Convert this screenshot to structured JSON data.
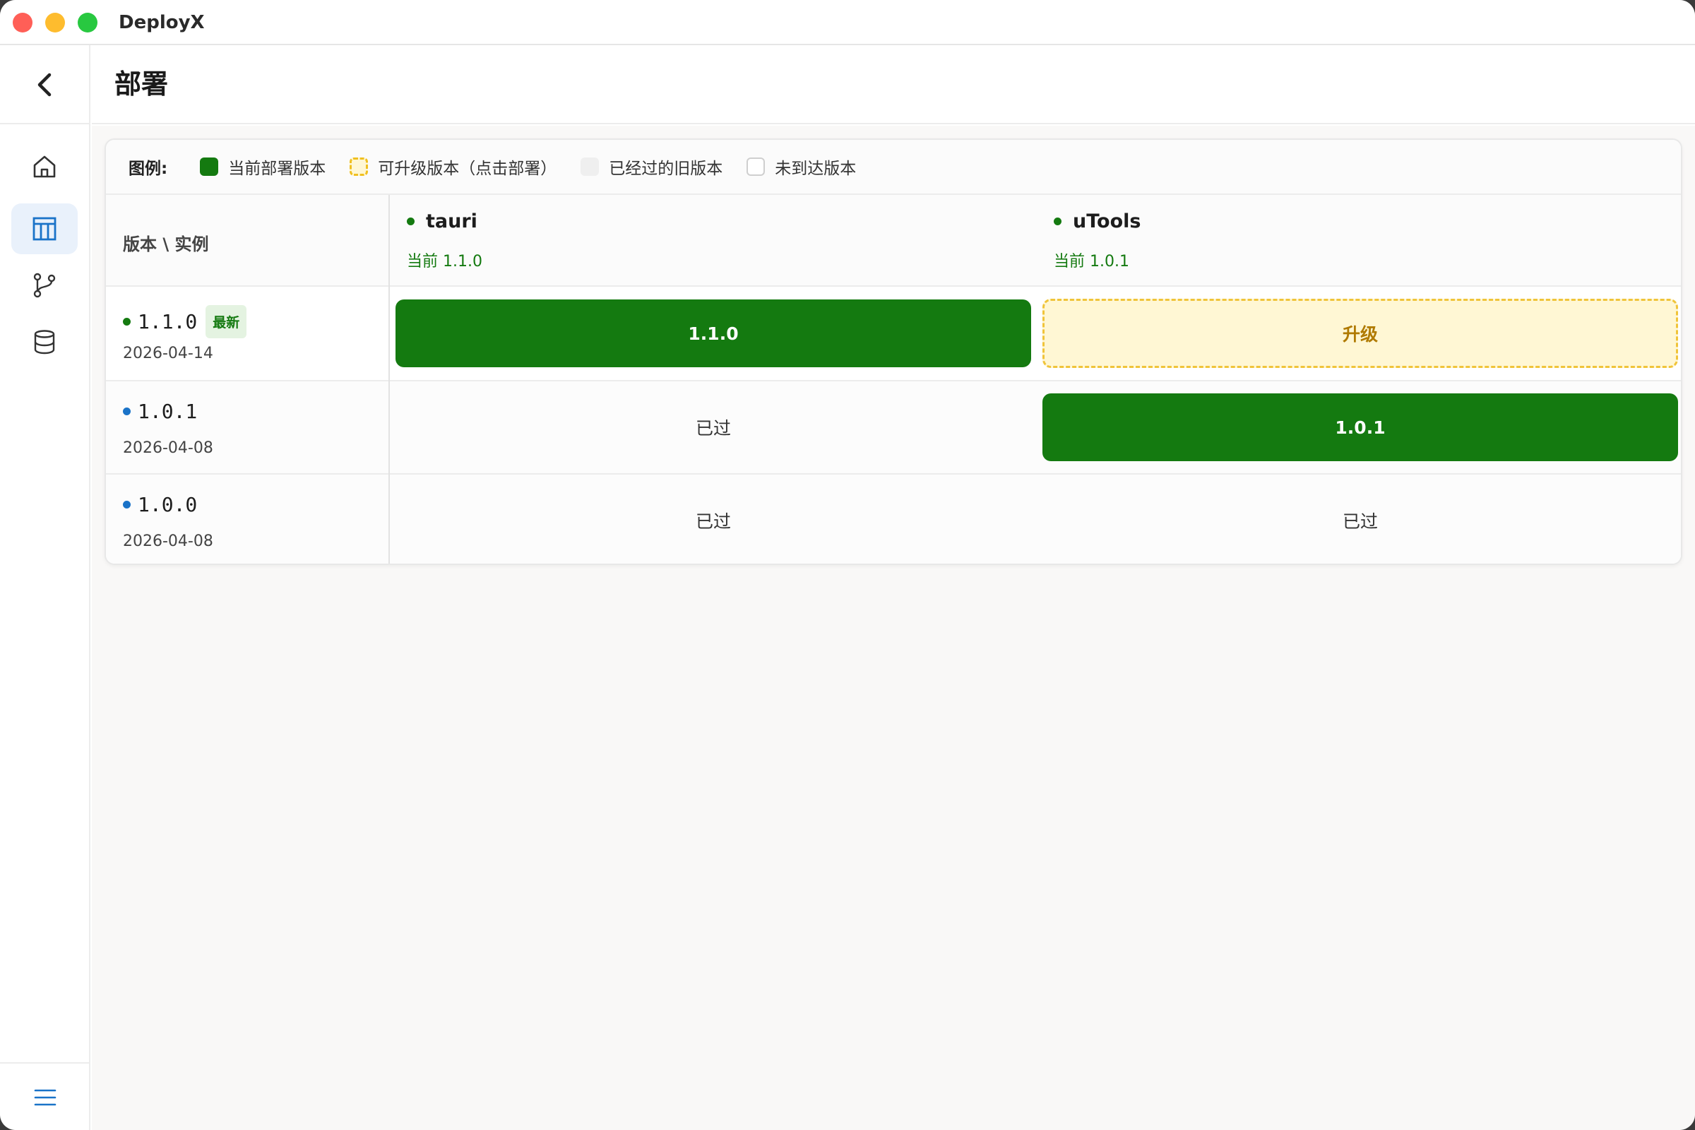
{
  "window": {
    "title": "DeployX"
  },
  "header": {
    "title": "部署"
  },
  "legend": {
    "title": "图例:",
    "items": [
      {
        "label": "当前部署版本",
        "color": "#147a10"
      },
      {
        "label": "可升级版本（点击部署）",
        "color": "#f0c020"
      },
      {
        "label": "已经过的旧版本",
        "color": "#efefef"
      },
      {
        "label": "未到达版本",
        "color": "#ffffff"
      }
    ]
  },
  "table": {
    "corner_label": "版本 \\ 实例",
    "instances": [
      {
        "name": "tauri",
        "current": "当前 1.1.0"
      },
      {
        "name": "uTools",
        "current": "当前 1.0.1"
      }
    ],
    "versions": [
      {
        "version": "1.1.0",
        "badge": "最新",
        "date": "2026-04-14",
        "cells": [
          "1.1.0",
          "升级"
        ]
      },
      {
        "version": "1.0.1",
        "date": "2026-04-08",
        "cells": [
          "已过",
          "1.0.1"
        ]
      },
      {
        "version": "1.0.0",
        "date": "2026-04-08",
        "cells": [
          "已过",
          "已过"
        ]
      }
    ]
  },
  "colors": {
    "accent_green": "#147a10",
    "accent_blue": "#1a73c8",
    "upgrade_text": "#b07a00"
  },
  "icons": {
    "back": "chevron-left-icon",
    "home": "home-icon",
    "deploy": "table-icon",
    "branch": "git-branch-icon",
    "database": "database-icon",
    "menu": "menu-icon"
  }
}
